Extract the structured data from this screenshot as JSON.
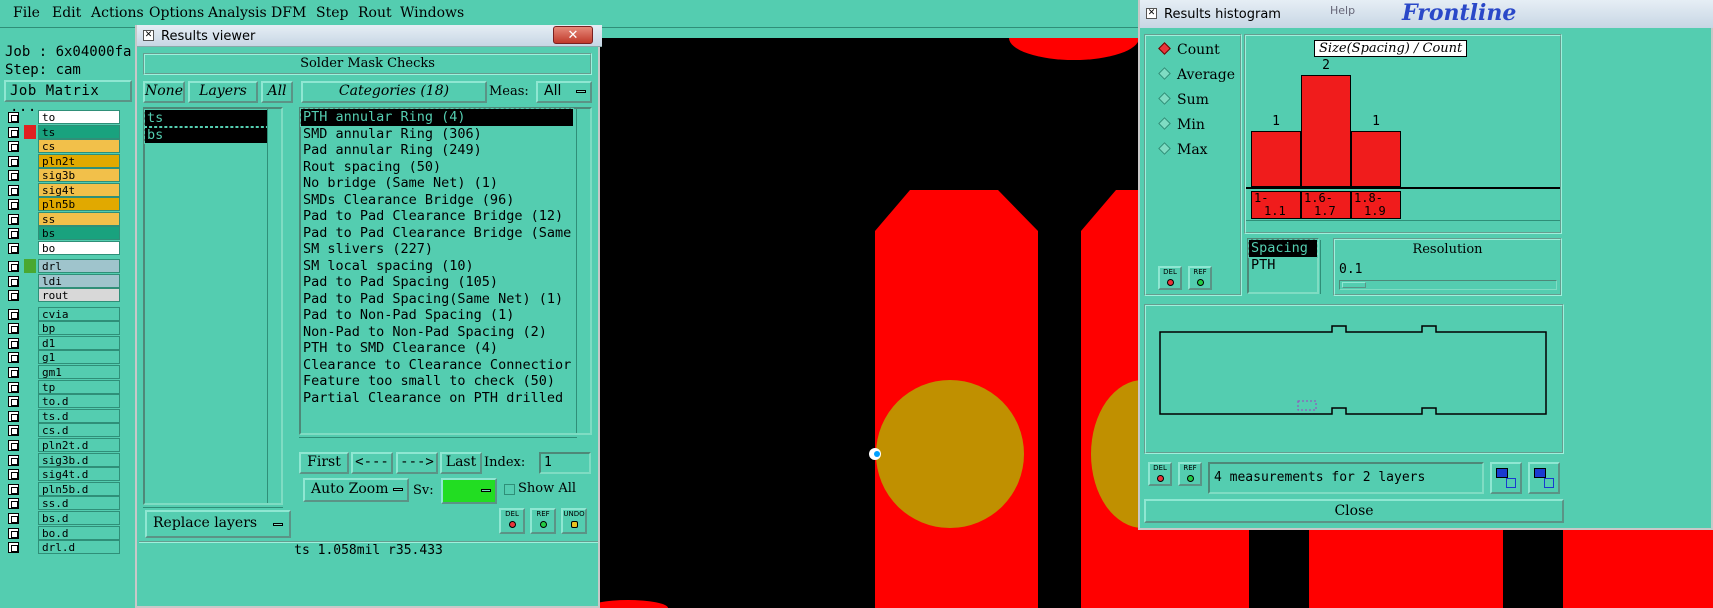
{
  "menu": {
    "file": "File",
    "edit": "Edit",
    "actions": "Actions",
    "options": "Options",
    "analysis": "Analysis",
    "dfm": "DFM",
    "step": "Step",
    "rout": "Rout",
    "windows": "Windows"
  },
  "job": {
    "job_line": "Job : 6x04000fa",
    "step_line": "Step: cam",
    "matrix_button": "Job Matrix ..."
  },
  "layers_group1": [
    "to",
    "ts",
    "cs",
    "pln2t",
    "sig3b",
    "sig4t",
    "pln5b",
    "ss",
    "bs",
    "bo"
  ],
  "layers_group2": [
    "drl",
    "ldi",
    "rout"
  ],
  "layers_group3": [
    "cvia",
    "bp",
    "d1",
    "g1",
    "gm1",
    "tp",
    "to.d",
    "ts.d",
    "cs.d",
    "pln2t.d",
    "sig3b.d",
    "sig4t.d",
    "pln5b.d",
    "ss.d",
    "bs.d",
    "bo.d",
    "drl.d"
  ],
  "viewer": {
    "title": "Results viewer",
    "close_glyph": "✕",
    "header": "Solder Mask Checks",
    "none_button": "None",
    "layers_button": "Layers",
    "all_button": "All",
    "categories_button": "Categories (18)",
    "meas_label": "Meas:",
    "meas_value": "All",
    "layers": [
      "ts",
      "bs"
    ],
    "categories": [
      "PTH annular Ring (4)",
      "SMD annular Ring (306)",
      "Pad annular Ring (249)",
      "Rout spacing (50)",
      "No bridge (Same Net) (1)",
      "SMDs Clearance Bridge (96)",
      "Pad to Pad Clearance Bridge (12)",
      "Pad to Pad Clearance Bridge (Same",
      "SM slivers (227)",
      "SM local spacing (10)",
      "Pad to Pad Spacing (105)",
      "Pad to Pad Spacing(Same Net) (1)",
      "Pad to Non-Pad Spacing (1)",
      "Non-Pad to Non-Pad Spacing (2)",
      "PTH to SMD Clearance (4)",
      "Clearance to Clearance Connectior",
      "Feature too small to check (50)",
      "Partial Clearance on PTH drilled"
    ],
    "first_button": "First",
    "prev_button": "<---",
    "next_button": "--->",
    "last_button": "Last",
    "index_label": "Index:",
    "index_value": "1",
    "autozoom_label": "Auto Zoom",
    "sv_label": "Sv:",
    "show_all_label": "Show All",
    "replace_layers_label": "Replace layers",
    "del_label": "DEL",
    "ref_label": "REF",
    "undo_label": "UNDO",
    "status": "ts 1.058mil   r35.433"
  },
  "histogram": {
    "title": "Results histogram",
    "modes": [
      "Count",
      "Average",
      "Sum",
      "Min",
      "Max"
    ],
    "selected_mode": "Count",
    "chart_title": "Size(Spacing) / Count",
    "bins": [
      {
        "label_top": "1-",
        "label_bottom": "1.1",
        "count": 1
      },
      {
        "label_top": "1.6-",
        "label_bottom": "1.7",
        "count": 2
      },
      {
        "label_top": "1.8-",
        "label_bottom": "1.9",
        "count": 1
      }
    ],
    "attribute_list": [
      "Spacing",
      "PTH"
    ],
    "resolution_label": "Resolution",
    "resolution_value": "0.1",
    "del_label": "DEL",
    "ref_label": "REF",
    "summary": "4 measurements for 2 layers",
    "close_label": "Close",
    "brand": "Frontline",
    "help_label": "Help"
  },
  "colors": {
    "panel": "#54cdb0",
    "pad_red": "#ff0000",
    "drill_gold": "#c09000",
    "canvas": "#000000"
  }
}
